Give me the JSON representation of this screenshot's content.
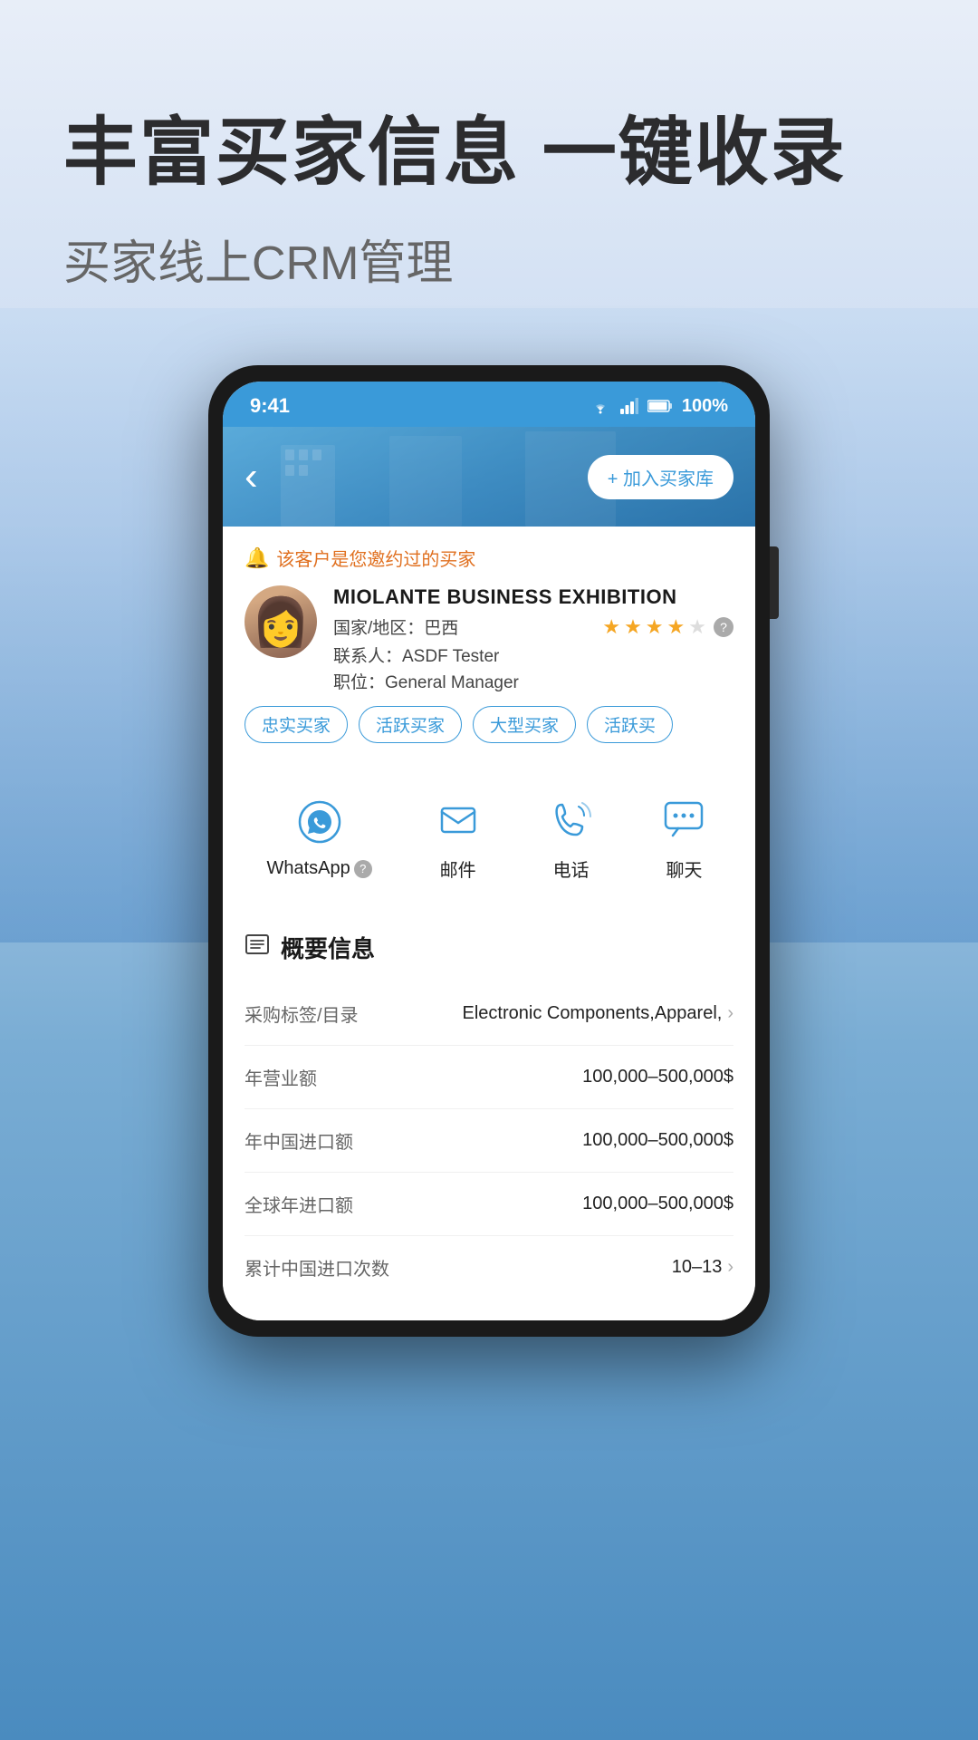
{
  "header": {
    "main_title": "丰富买家信息 一键收录",
    "sub_title": "买家线上CRM管理"
  },
  "status_bar": {
    "time": "9:41",
    "battery": "100%",
    "wifi_icon": "wifi",
    "signal_icon": "signal",
    "battery_icon": "battery"
  },
  "phone_screen": {
    "back_button": "‹",
    "add_buyer_button": "+ 加入买家库",
    "customer_notice": "该客户是您邀约过的买家",
    "company_name": "MIOLANTE BUSINESS EXHIBITION",
    "country_label": "国家/地区：巴西",
    "stars_filled": 4,
    "stars_empty": 1,
    "contact_label": "联系人：ASDF Tester",
    "position_label": "职位：General Manager",
    "tags": [
      "忠实买家",
      "活跃买家",
      "大型买家",
      "活跃买"
    ],
    "actions": [
      {
        "id": "whatsapp",
        "label": "WhatsApp",
        "has_help": true
      },
      {
        "id": "email",
        "label": "邮件",
        "has_help": false
      },
      {
        "id": "phone",
        "label": "电话",
        "has_help": false
      },
      {
        "id": "chat",
        "label": "聊天",
        "has_help": false
      }
    ],
    "overview_title": "概要信息",
    "info_rows": [
      {
        "label": "采购标签/目录",
        "value": "Electronic Components,Apparel,",
        "has_chevron": true
      },
      {
        "label": "年营业额",
        "value": "100,000–500,000$",
        "has_chevron": false
      },
      {
        "label": "年中国进口额",
        "value": "100,000–500,000$",
        "has_chevron": false
      },
      {
        "label": "全球年进口额",
        "value": "100,000–500,000$",
        "has_chevron": false
      },
      {
        "label": "累计中国进口次数",
        "value": "10–13",
        "has_chevron": true
      }
    ]
  },
  "colors": {
    "primary_blue": "#3a9ad9",
    "orange": "#e07020",
    "star_yellow": "#f5a623"
  }
}
